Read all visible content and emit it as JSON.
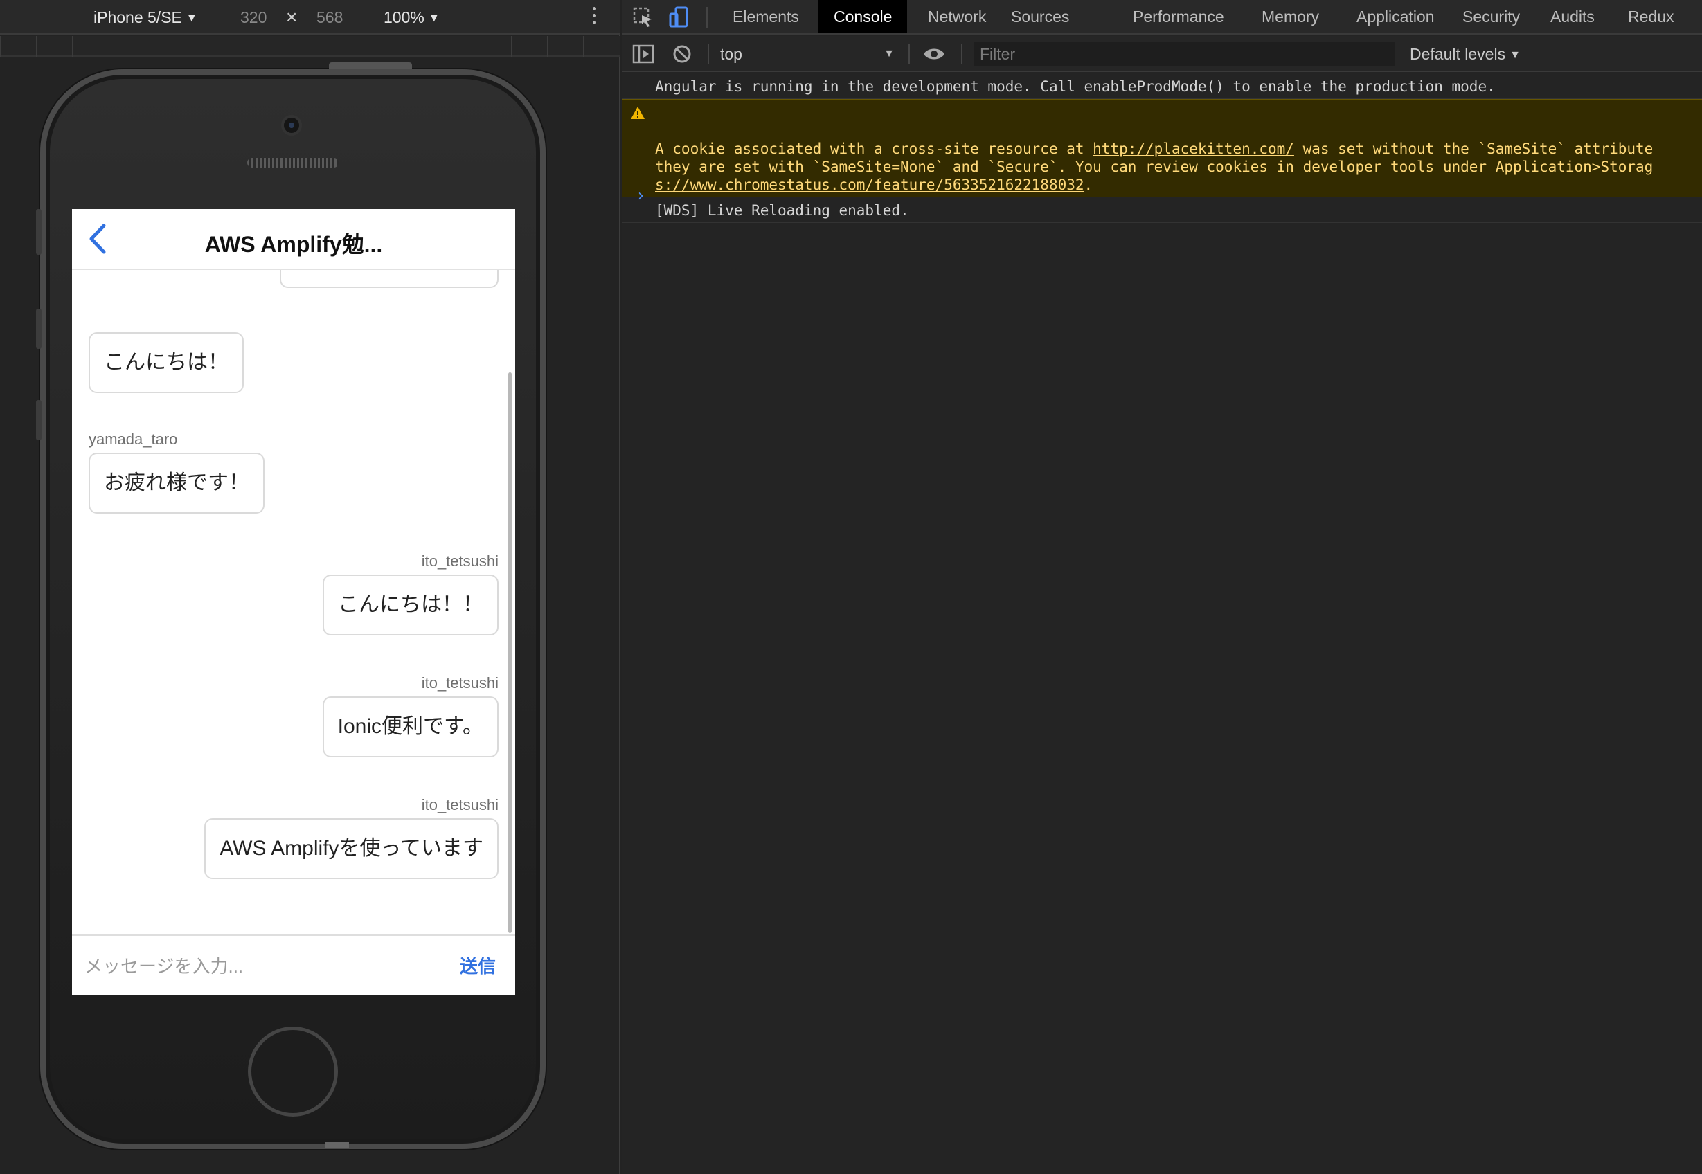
{
  "device_toolbar": {
    "device": "iPhone 5/SE",
    "width": "320",
    "times": "×",
    "height": "568",
    "zoom": "100%"
  },
  "app": {
    "title": "AWS Amplify勉...",
    "messages": [
      {
        "side": "left",
        "sender": "",
        "text": "こんにちは！"
      },
      {
        "side": "left",
        "sender": "yamada_taro",
        "text": "お疲れ様です！"
      },
      {
        "side": "right",
        "sender": "ito_tetsushi",
        "text": "こんにちは！！"
      },
      {
        "side": "right",
        "sender": "ito_tetsushi",
        "text": "Ionic便利です。"
      },
      {
        "side": "right",
        "sender": "ito_tetsushi",
        "text": "AWS Amplifyを使っています"
      }
    ],
    "input_placeholder": "メッセージを入力...",
    "send_label": "送信",
    "accent": "#3171e0"
  },
  "devtools": {
    "tabs": [
      "Elements",
      "Console",
      "Network",
      "Sources",
      "Performance",
      "Memory",
      "Application",
      "Security",
      "Audits",
      "Redux"
    ],
    "active_tab": "Console",
    "context": "top",
    "filter_placeholder": "Filter",
    "levels": "Default levels",
    "console": {
      "line1": "Angular is running in the development mode. Call enableProdMode() to enable the production mode.",
      "warn_a": "A cookie associated with a cross-site resource at ",
      "warn_link1": "http://placekitten.com/",
      "warn_b": " was set without the `SameSite` attribute",
      "warn_line2": "they are set with `SameSite=None` and `Secure`. You can review cookies in developer tools under Application>Storag",
      "warn_link2": "s://www.chromestatus.com/feature/5633521622188032",
      "warn_end": ".",
      "line3": "[WDS] Live Reloading enabled.",
      "prompt": "›"
    },
    "warn_color": "#ffd97a"
  }
}
